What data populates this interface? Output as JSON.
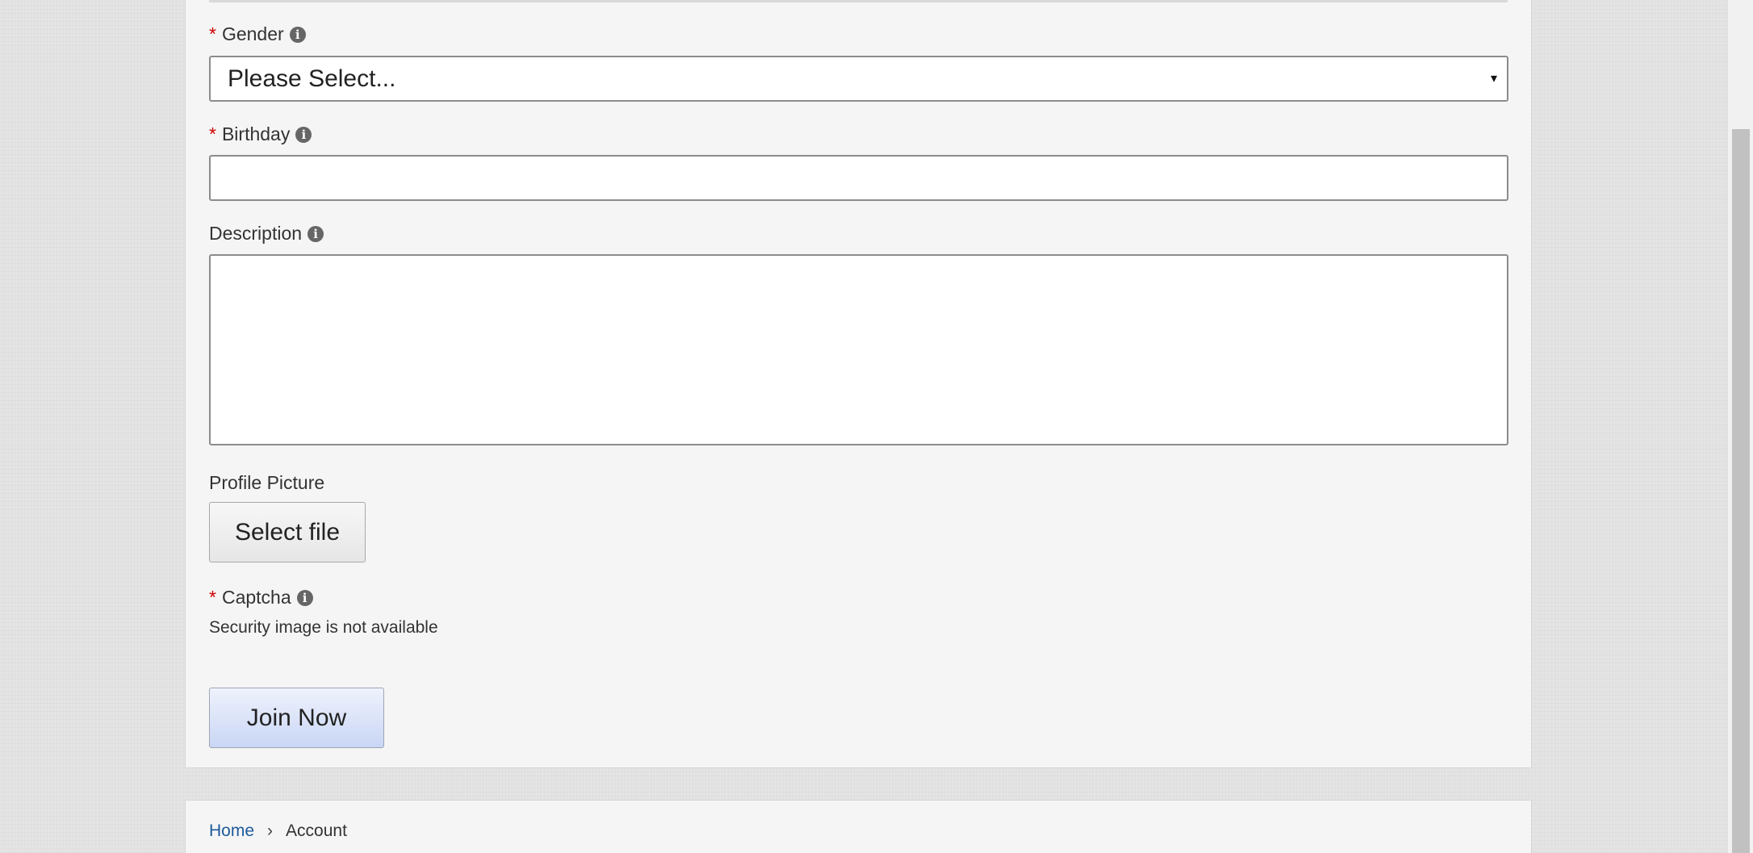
{
  "form": {
    "gender": {
      "label": "Gender",
      "required_mark": "*",
      "info_icon": "info-circle-icon",
      "selected_value": "Please Select...",
      "caret": "▾"
    },
    "birthday": {
      "label": "Birthday",
      "required_mark": "*",
      "info_icon": "info-circle-icon",
      "value": ""
    },
    "description": {
      "label": "Description",
      "info_icon": "info-circle-icon",
      "value": ""
    },
    "profile_picture": {
      "label": "Profile Picture",
      "button_label": "Select file"
    },
    "captcha": {
      "label": "Captcha",
      "required_mark": "*",
      "info_icon": "info-circle-icon",
      "message": "Security image is not available"
    },
    "submit": {
      "label": "Join Now"
    }
  },
  "breadcrumb": {
    "items": [
      {
        "label": "Home"
      },
      {
        "label": "Account"
      }
    ],
    "separator": "›"
  },
  "colors": {
    "required": "#d00000",
    "link": "#1c5a9c",
    "submit_top": "#eff2fc",
    "submit_bottom": "#c9d6f5",
    "card_background": "#f5f5f5",
    "page_background": "#e2e2e2"
  }
}
